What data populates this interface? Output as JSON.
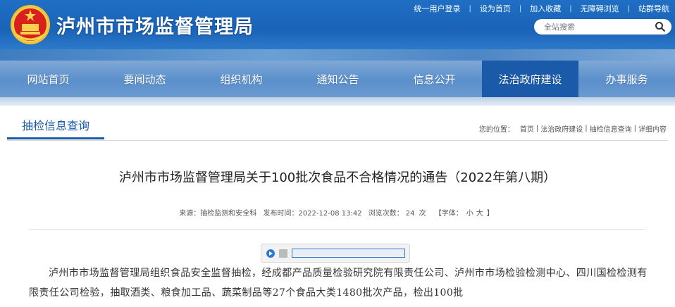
{
  "header": {
    "site_title": "泸州市市场监督管理局",
    "top_links": [
      "统一用户登录",
      "设为首页",
      "加入收藏",
      "无障碍浏览",
      "站群导航"
    ],
    "search_placeholder": "全站搜索",
    "brand_color": "#1a63b8"
  },
  "nav": {
    "items": [
      "网站首页",
      "要闻动态",
      "组织机构",
      "通知公告",
      "信息公开",
      "法治政府建设",
      "办事服务"
    ],
    "active_index": 5,
    "active_color": "#1b5aa8"
  },
  "section": {
    "title": "抽检信息查询",
    "breadcrumb_lead": "您的位置：",
    "breadcrumb": [
      "首页",
      "法治政府建设",
      "抽检信息查询",
      "详细内容"
    ],
    "sep": "|"
  },
  "article": {
    "title": "泸州市市场监督管理局关于100批次食品不合格情况的通告（2022年第八期）",
    "source_label": "来源：",
    "source": "抽检监测和安全科",
    "date_label": "发布时间：",
    "date": "2022-12-08 13:42",
    "views_label": "浏览次数：",
    "views": "24",
    "views_unit": "次",
    "font_label": "【字体：",
    "font_small": "小",
    "font_large": "大",
    "font_close": "】",
    "paragraph": "泸州市市场监督管理局组织食品安全监督抽检，经成都产品质量检验研究院有限责任公司、泸州市市场检验检测中心、四川国检检测有限责任公司检验，抽取酒类、粮食加工品、蔬菜制品等27个食品大类1480批次产品，检出100批"
  }
}
